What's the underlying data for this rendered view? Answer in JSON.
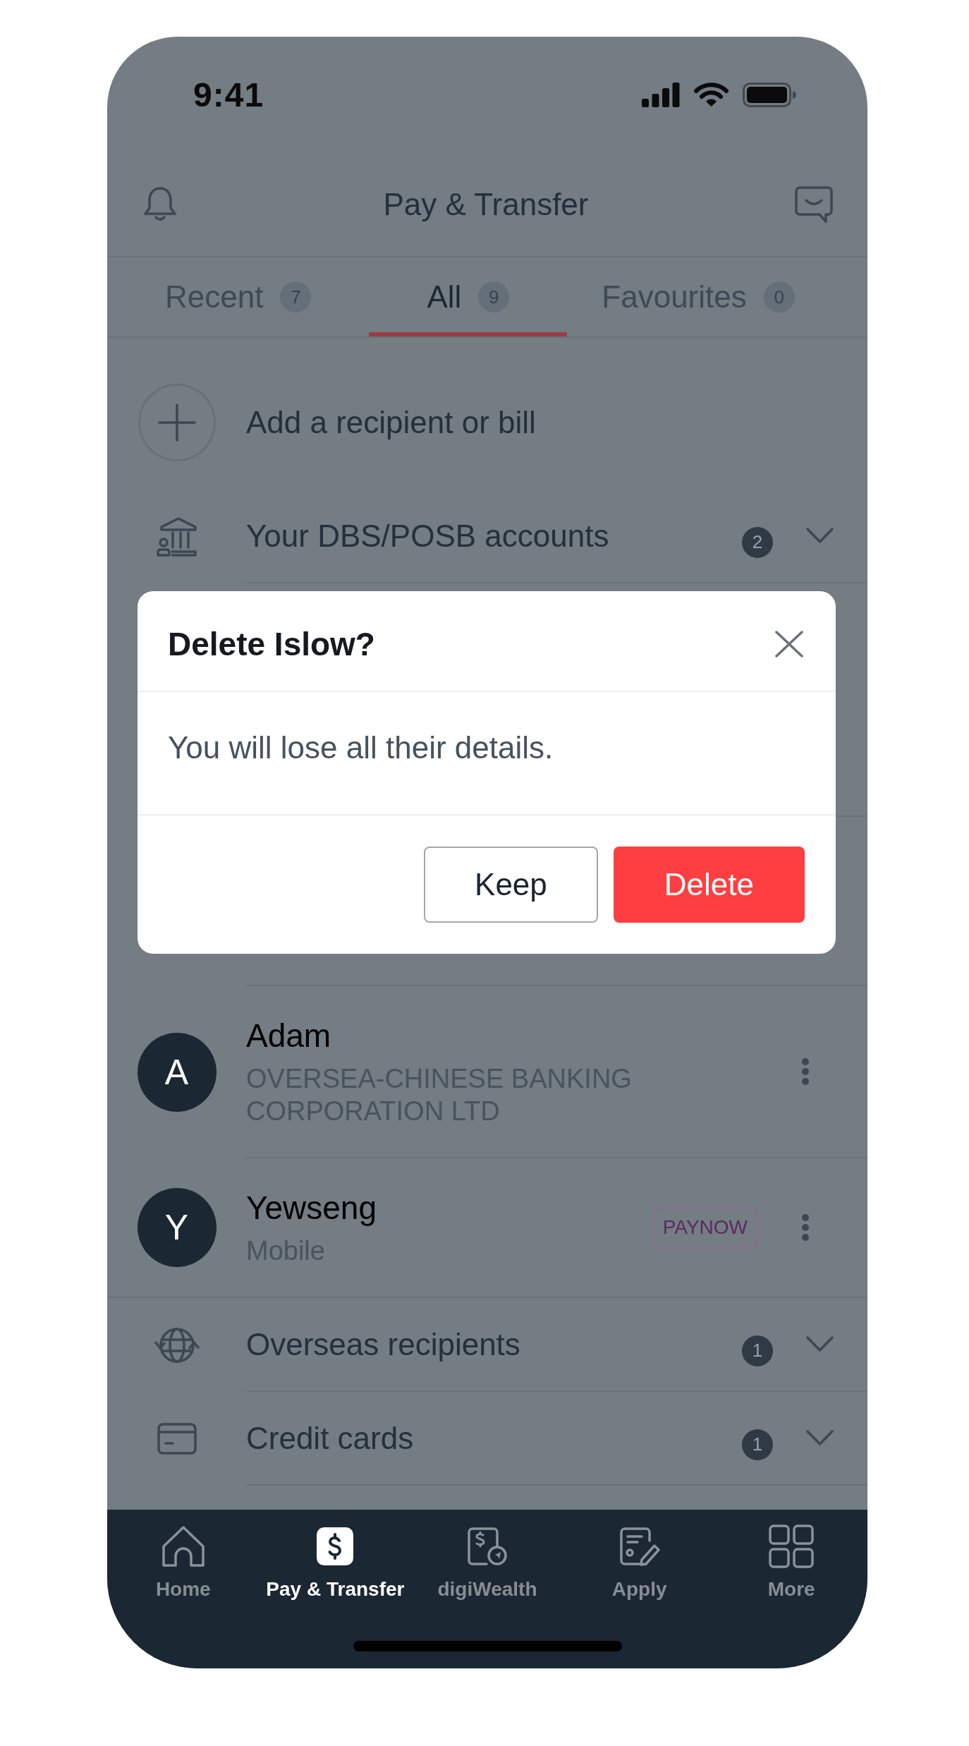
{
  "status_bar": {
    "time": "9:41"
  },
  "header": {
    "title": "Pay & Transfer"
  },
  "tabs": [
    {
      "label": "Recent",
      "count": "7",
      "selected": false
    },
    {
      "label": "All",
      "count": "9",
      "selected": true
    },
    {
      "label": "Favourites",
      "count": "0",
      "selected": false
    }
  ],
  "add_action": {
    "label": "Add a recipient or bill"
  },
  "top_groups": [
    {
      "kind": "accounts",
      "label": "Your DBS/POSB accounts",
      "count": "2",
      "expanded": false
    }
  ],
  "recipients": [
    {
      "initial": "A",
      "name": "Adam",
      "detail": "OVERSEA-CHINESE BANKING CORPORATION LTD"
    },
    {
      "initial": "Y",
      "name": "Yewseng",
      "detail": "Mobile",
      "tag": "PAYNOW"
    }
  ],
  "bottom_groups": [
    {
      "kind": "overseas",
      "label": "Overseas recipients",
      "count": "1",
      "expanded": false
    },
    {
      "kind": "cards",
      "label": "Credit cards",
      "count": "1",
      "expanded": false
    }
  ],
  "dialog": {
    "title": "Delete Islow?",
    "message": "You will lose all their details.",
    "buttons": [
      {
        "kind": "secondary",
        "label": "Keep"
      },
      {
        "kind": "danger",
        "label": "Delete"
      }
    ]
  },
  "bottom_nav": [
    {
      "kind": "home",
      "label": "Home",
      "selected": false
    },
    {
      "kind": "pay",
      "label": "Pay & Transfer",
      "selected": true
    },
    {
      "kind": "wealth",
      "label": "digiWealth",
      "selected": false
    },
    {
      "kind": "apply",
      "label": "Apply",
      "selected": false
    },
    {
      "kind": "more",
      "label": "More",
      "selected": false
    }
  ]
}
